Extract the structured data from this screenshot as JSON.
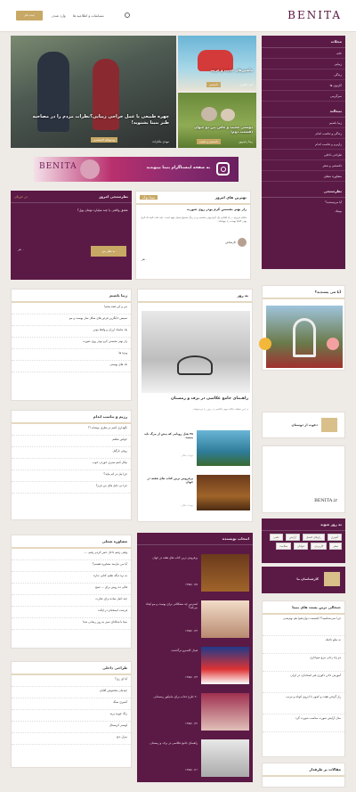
{
  "header": {
    "logo": "BENITA",
    "nav": [
      "مسابقات و اطلاعیه ها",
      "وارد شدن"
    ],
    "login_button": "ثبت نام"
  },
  "sidebar": {
    "title": "مجلات",
    "items": [
      "خانه",
      "زیبایی",
      "زندگی",
      "کارتون ها",
      "سرگرمی"
    ],
    "sub_title": "بنیتالند",
    "sub_items": [
      "زیبا باشیم",
      "زندگی و تناسب اندام",
      "رازبرم و تناسب اندام",
      "طراحی داخلی",
      "دانستنی و شعر",
      "مشاوره شغلی"
    ],
    "poll_title": "نظرسنجی",
    "poll_q": "آیا می‌پسندید؟",
    "poll_q2": "بیبیتک"
  },
  "hero": {
    "title": "چهره طبیعی یا عمل جراحی زیبایی؟نظرات مردم را در مصاحبه طنز بنیتا بشنوید!",
    "author": "مهدی ملکزاده",
    "tag": "ویدیوهای اختصاصی"
  },
  "side_cards": [
    {
      "title": "ماشین‌های عجیب و غریب",
      "author": "امید جعفری",
      "tag": "دانستنی"
    },
    {
      "title": "دوستی عجیب و خاص بین دو حیوان (قسمت دوم)",
      "author": "رضا رحیم‌پور",
      "tag": "دانستنی و عجیب"
    }
  ],
  "banner": {
    "brand": "BENITA",
    "text": "به صفحه اینستاگرام بنیتا بپیوندید"
  },
  "question": {
    "title": "نظرسنجی امروز",
    "sub": "در جریان",
    "q": "عشق واقعی یا چند میلیارد تومان پول؟",
    "button": "به نظر من",
    "votes": "۰ نفر"
  },
  "best_answers": {
    "title": "بهترین های امروز",
    "badge": "بنیتا بوک",
    "q": "راز بهتر نشستن کرم پودر روی صورت",
    "body": "سلام عزیزم... راه افتادن یک کرم پودر مناسب و در رنگ صحیح بسیار مهم است. باید دقت کنید که کرم پودر کاملا پوست را بپوشاند.",
    "user": "کارشناس",
    "votes": "۰ نفر"
  },
  "left_col1": {
    "title": "زیبا باشیم",
    "items": [
      "من و این همه پشم!",
      "سیبس جایگزین قرص های سکل ساز پوست و مو",
      "یک ماسک ارزان و واقعا موثر",
      "راز بهتر نشستن کرم پودر روی صورت",
      "ویژه ها",
      "تک های پوستی"
    ]
  },
  "left_col2": {
    "title": "رژیم و تناسب اندام",
    "items": [
      "نگهداری آنتیم در بطری نوشابه !؟",
      "حواس شلغم",
      "روغن نارگیل",
      "بیکار کنیم سبزی خوردن خوب",
      "چرا بیل در کم بیاید؟",
      "چرا نی دلیل های من فرم؟"
    ]
  },
  "left_col3": {
    "title": "مشاوره شغلی",
    "items": [
      "وقتی رفیم داخل حس کردم رفتم، ...",
      "آیا من نیازمند مشاوره هستم؟",
      "به نره دیگه تعلیم کتابی نداره",
      "قالی ده روش برای ... صبح",
      "چند اصل ساده برای تجارت",
      "فرصت استخدام در ایالت",
      "بنیتا با شکاتای تمیز به روز رسانی شد!"
    ]
  },
  "left_col4": {
    "title": "طراحی داخلی",
    "items": [
      "آیا ای زی؟",
      "چیدمان مخصوص آقایان",
      "آشپزی سنگ",
      "رنگ چهره پریه",
      "لوستر کریستال",
      "منزل دنج"
    ]
  },
  "daily": {
    "title": "به روز",
    "main_title": "راهنمای جامع عکاسی در برف و زمستان",
    "main_desc": "در این مطلب نکات مهم عکاسی در برف را می‌خوانید.",
    "list": [
      {
        "title": "۴۸ هتل رویایی که پیش از مرگ باید ببینید.",
        "meta": "مهدی ملکی"
      },
      {
        "title": "پرفروش ترین کتاب های هفته در جهان",
        "meta": "مهدی ملکی"
      }
    ]
  },
  "editor_pick": {
    "title": "انتخاب نویسنده",
    "items": [
      {
        "title": "پرفروش ترین کتاب های هفته در جهان",
        "date": "۱۳۹۵/۱۰/۲۵"
      },
      {
        "title": "استرس چه مشکلاتی برای پوست و مو ایجاد می‌کند؟",
        "date": "۱۳۹۵/۱۰/۲۴"
      },
      {
        "title": "فیدل کاسترو درگذشت",
        "date": "۱۳۹۵/۱۰/۲۳"
      },
      {
        "title": "۲۰ طرح جذاب برای مانیکور زمستانی",
        "date": "۱۳۹۵/۱۰/۲۲"
      },
      {
        "title": "راهنمای جامع عکاسی در برف و زمستان",
        "date": "۱۳۹۵/۱۰/۲۱"
      }
    ]
  },
  "right2": {
    "poll_title": "آیا می پسندید؟",
    "invite": "دعوت از دوستان",
    "site": "BENITA.ir",
    "tags_title": "به روز شوید",
    "tags": [
      "آشپزی",
      "رازهای کنسل",
      "آرایش",
      "علمی",
      "سفر",
      "کاربردی",
      "جوانان",
      "سلامت"
    ],
    "experts": "کارشناسان ما",
    "hot_title": "جنجالی ترین پست های بنیتا",
    "hot": [
      "چرا نمی‌شناسید؟! (قسمت دوازدهم) هم نهم‌شنی",
      "نه نیکو تاجیک",
      "دو راه زنانی مرغ سوخاری",
      "آموزش ناخن دکوری غیر استاندارد در ایران",
      "راز گرفتن هفت و کمون تا ابروی کوتاه و مرتب",
      "مدل آرایش صورت مناسب صورت گرد"
    ],
    "more": "مقالات پر طرفدار"
  }
}
